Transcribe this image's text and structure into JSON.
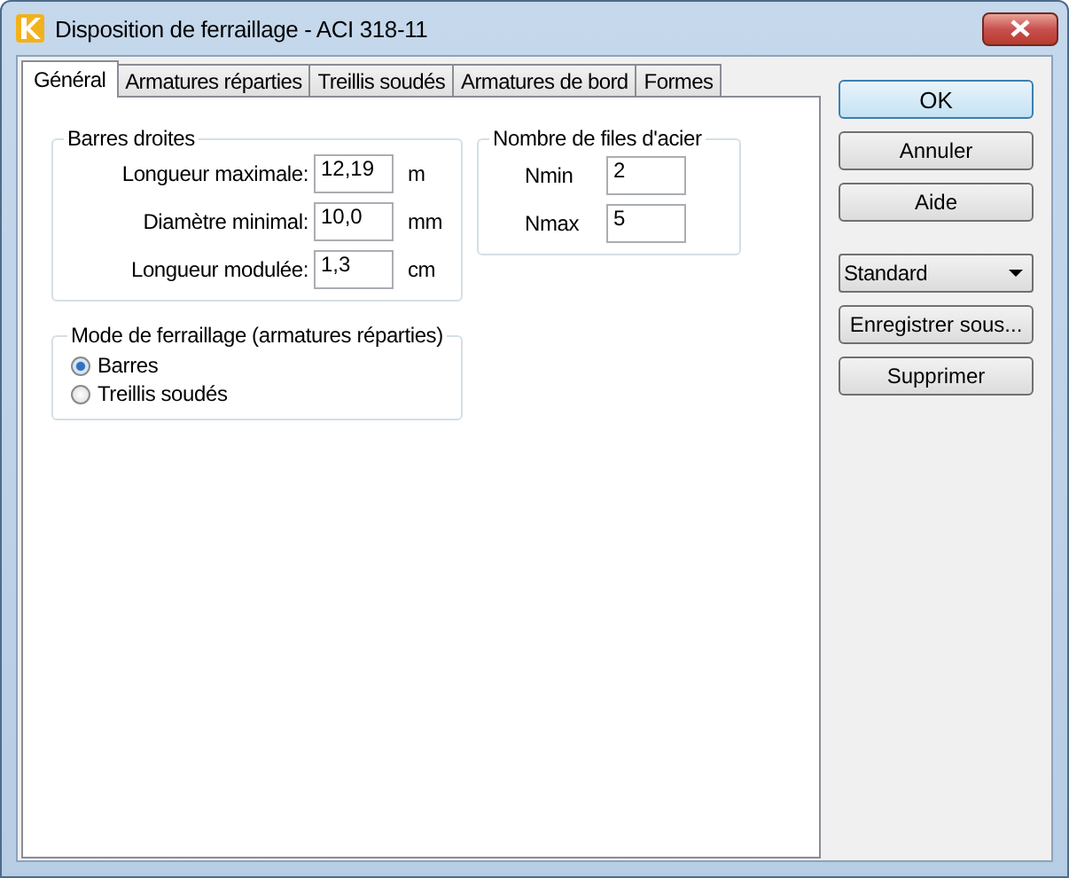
{
  "window": {
    "title": "Disposition de ferraillage - ACI 318-11"
  },
  "tabs": [
    {
      "label": "Général",
      "selected": true
    },
    {
      "label": "Armatures réparties",
      "selected": false
    },
    {
      "label": "Treillis soudés",
      "selected": false
    },
    {
      "label": "Armatures de bord",
      "selected": false
    },
    {
      "label": "Formes",
      "selected": false
    }
  ],
  "straight_bars": {
    "title": "Barres droites",
    "fields": [
      {
        "label": "Longueur maximale:",
        "value": "12,19",
        "unit": "m"
      },
      {
        "label": "Diamètre minimal:",
        "value": "10,0",
        "unit": "mm"
      },
      {
        "label": "Longueur modulée:",
        "value": "1,3",
        "unit": "cm"
      }
    ]
  },
  "steel_rows": {
    "title": "Nombre de files d'acier",
    "fields": [
      {
        "label": "Nmin",
        "value": "2"
      },
      {
        "label": "Nmax",
        "value": "5"
      }
    ]
  },
  "mode": {
    "title": "Mode de ferraillage (armatures réparties)",
    "options": [
      {
        "label": "Barres",
        "selected": true
      },
      {
        "label": "Treillis soudés",
        "selected": false
      }
    ]
  },
  "buttons": [
    {
      "label": "OK",
      "default": true
    },
    {
      "label": "Annuler",
      "default": false
    },
    {
      "label": "Aide",
      "default": false
    }
  ],
  "preset": {
    "value": "Standard"
  },
  "preset_buttons": [
    "Enregistrer sous...",
    "Supprimer"
  ]
}
